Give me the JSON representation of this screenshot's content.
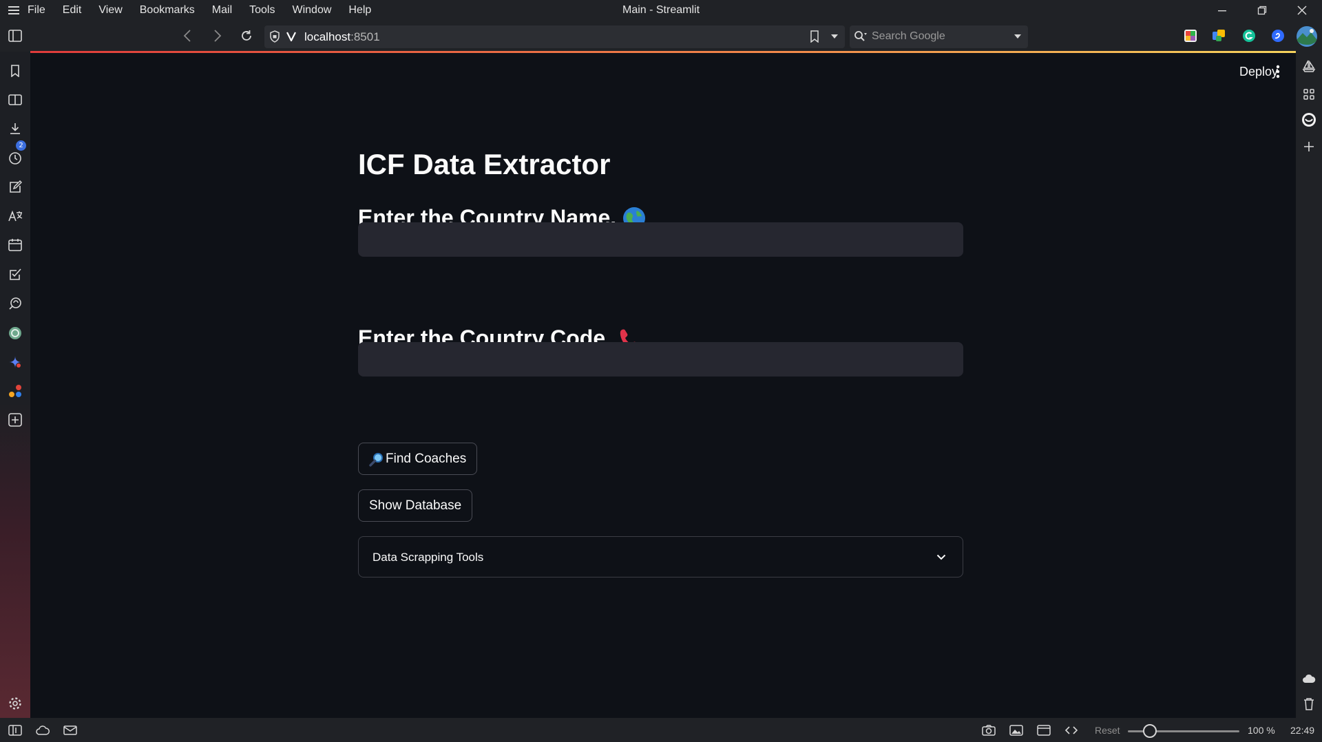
{
  "window": {
    "title": "Main - Streamlit",
    "menu": [
      "File",
      "Edit",
      "View",
      "Bookmarks",
      "Mail",
      "Tools",
      "Window",
      "Help"
    ]
  },
  "address_bar": {
    "url_host": "localhost",
    "url_port": ":8501",
    "search_placeholder": "Search Google"
  },
  "sidebar": {
    "tabs_badge": "2",
    "items": [
      "bookmark-icon",
      "tabs-icon",
      "download-icon",
      "history-icon",
      "notes-icon",
      "translate-icon",
      "calendar-icon",
      "tasks-icon",
      "feed-icon",
      "chatgpt-icon",
      "gemini-icon",
      "slack-icon",
      "add-panel-icon",
      "settings-icon"
    ]
  },
  "app": {
    "deploy_label": "Deploy",
    "title": "ICF Data Extractor",
    "country_name_header": "Enter the Country Name.",
    "country_name_value": "",
    "country_code_header": "Enter the Country Code.",
    "country_code_value": "",
    "find_coaches_label": "Find Coaches",
    "show_database_label": "Show Database",
    "expander_label": "Data Scrapping Tools"
  },
  "status_bar": {
    "reset_label": "Reset",
    "zoom": "100 %",
    "zoom_level": 1.0,
    "clock": "22:49"
  },
  "colors": {
    "background": "#0e1117",
    "input_bg": "#262730",
    "chrome": "#202226"
  }
}
